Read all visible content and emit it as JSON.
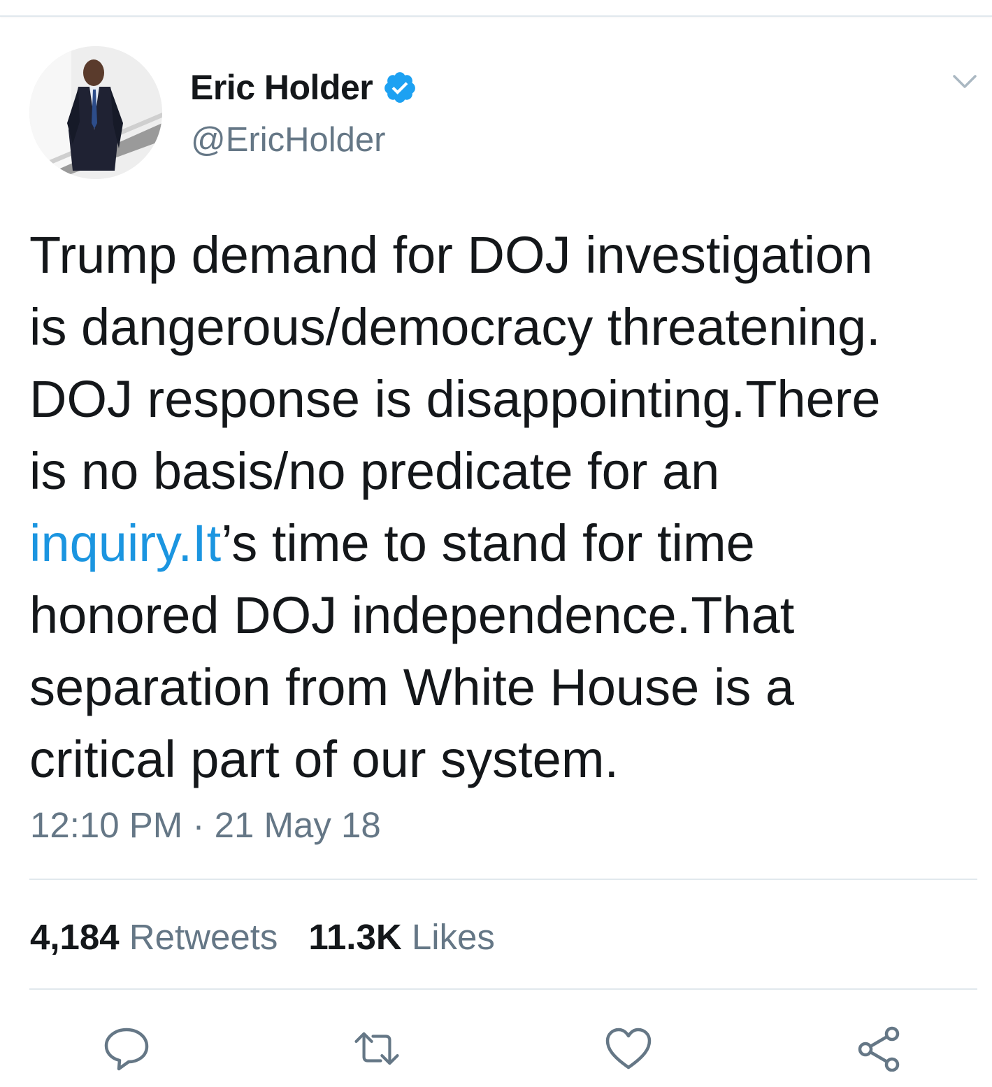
{
  "tweet": {
    "author": {
      "name": "Eric Holder",
      "handle": "@EricHolder",
      "verified": true
    },
    "text_lines": [
      {
        "before": "Trump demand for DOJ investigation",
        "link": "",
        "after": ""
      },
      {
        "before": "is dangerous/democracy threatening.",
        "link": "",
        "after": ""
      },
      {
        "before": "DOJ response is disappointing.There",
        "link": "",
        "after": ""
      },
      {
        "before": "is no basis/no predicate for an",
        "link": "",
        "after": ""
      },
      {
        "before": "",
        "link": "inquiry.It",
        "after": "’s time to stand for time"
      },
      {
        "before": "honored DOJ independence.That",
        "link": "",
        "after": ""
      },
      {
        "before": "separation from White House is a",
        "link": "",
        "after": ""
      },
      {
        "before": "critical part of our system.",
        "link": "",
        "after": ""
      }
    ],
    "timestamp": "12:10 PM · 21 May 18",
    "stats": {
      "retweets_count": "4,184",
      "retweets_label": "Retweets",
      "likes_count": "11.3K",
      "likes_label": "Likes"
    }
  },
  "actions": [
    {
      "icon": "reply-icon"
    },
    {
      "icon": "retweet-icon"
    },
    {
      "icon": "like-icon"
    },
    {
      "icon": "share-icon"
    }
  ],
  "colors": {
    "text": "#14171a",
    "secondary": "#657786",
    "link": "#1b95e0",
    "verified_badge": "#1da1f2",
    "divider": "#e1e8ed"
  }
}
